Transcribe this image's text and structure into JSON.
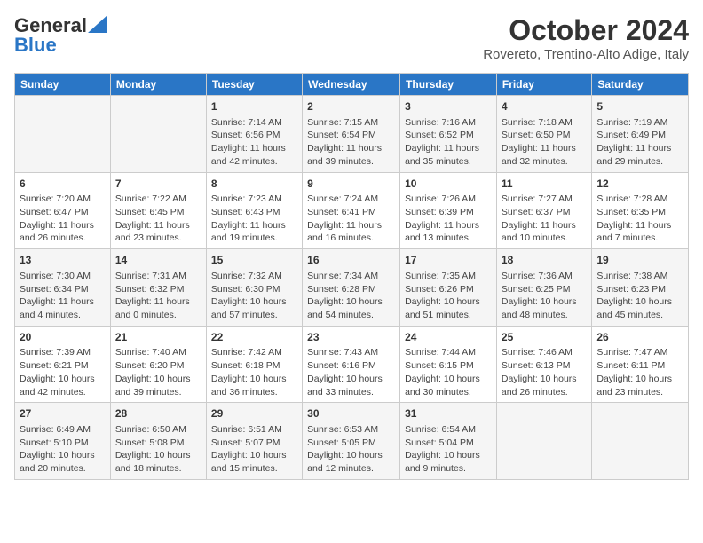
{
  "header": {
    "logo_general": "General",
    "logo_blue": "Blue",
    "month": "October 2024",
    "location": "Rovereto, Trentino-Alto Adige, Italy"
  },
  "days_of_week": [
    "Sunday",
    "Monday",
    "Tuesday",
    "Wednesday",
    "Thursday",
    "Friday",
    "Saturday"
  ],
  "weeks": [
    [
      {
        "day": "",
        "content": ""
      },
      {
        "day": "",
        "content": ""
      },
      {
        "day": "1",
        "content": "Sunrise: 7:14 AM\nSunset: 6:56 PM\nDaylight: 11 hours and 42 minutes."
      },
      {
        "day": "2",
        "content": "Sunrise: 7:15 AM\nSunset: 6:54 PM\nDaylight: 11 hours and 39 minutes."
      },
      {
        "day": "3",
        "content": "Sunrise: 7:16 AM\nSunset: 6:52 PM\nDaylight: 11 hours and 35 minutes."
      },
      {
        "day": "4",
        "content": "Sunrise: 7:18 AM\nSunset: 6:50 PM\nDaylight: 11 hours and 32 minutes."
      },
      {
        "day": "5",
        "content": "Sunrise: 7:19 AM\nSunset: 6:49 PM\nDaylight: 11 hours and 29 minutes."
      }
    ],
    [
      {
        "day": "6",
        "content": "Sunrise: 7:20 AM\nSunset: 6:47 PM\nDaylight: 11 hours and 26 minutes."
      },
      {
        "day": "7",
        "content": "Sunrise: 7:22 AM\nSunset: 6:45 PM\nDaylight: 11 hours and 23 minutes."
      },
      {
        "day": "8",
        "content": "Sunrise: 7:23 AM\nSunset: 6:43 PM\nDaylight: 11 hours and 19 minutes."
      },
      {
        "day": "9",
        "content": "Sunrise: 7:24 AM\nSunset: 6:41 PM\nDaylight: 11 hours and 16 minutes."
      },
      {
        "day": "10",
        "content": "Sunrise: 7:26 AM\nSunset: 6:39 PM\nDaylight: 11 hours and 13 minutes."
      },
      {
        "day": "11",
        "content": "Sunrise: 7:27 AM\nSunset: 6:37 PM\nDaylight: 11 hours and 10 minutes."
      },
      {
        "day": "12",
        "content": "Sunrise: 7:28 AM\nSunset: 6:35 PM\nDaylight: 11 hours and 7 minutes."
      }
    ],
    [
      {
        "day": "13",
        "content": "Sunrise: 7:30 AM\nSunset: 6:34 PM\nDaylight: 11 hours and 4 minutes."
      },
      {
        "day": "14",
        "content": "Sunrise: 7:31 AM\nSunset: 6:32 PM\nDaylight: 11 hours and 0 minutes."
      },
      {
        "day": "15",
        "content": "Sunrise: 7:32 AM\nSunset: 6:30 PM\nDaylight: 10 hours and 57 minutes."
      },
      {
        "day": "16",
        "content": "Sunrise: 7:34 AM\nSunset: 6:28 PM\nDaylight: 10 hours and 54 minutes."
      },
      {
        "day": "17",
        "content": "Sunrise: 7:35 AM\nSunset: 6:26 PM\nDaylight: 10 hours and 51 minutes."
      },
      {
        "day": "18",
        "content": "Sunrise: 7:36 AM\nSunset: 6:25 PM\nDaylight: 10 hours and 48 minutes."
      },
      {
        "day": "19",
        "content": "Sunrise: 7:38 AM\nSunset: 6:23 PM\nDaylight: 10 hours and 45 minutes."
      }
    ],
    [
      {
        "day": "20",
        "content": "Sunrise: 7:39 AM\nSunset: 6:21 PM\nDaylight: 10 hours and 42 minutes."
      },
      {
        "day": "21",
        "content": "Sunrise: 7:40 AM\nSunset: 6:20 PM\nDaylight: 10 hours and 39 minutes."
      },
      {
        "day": "22",
        "content": "Sunrise: 7:42 AM\nSunset: 6:18 PM\nDaylight: 10 hours and 36 minutes."
      },
      {
        "day": "23",
        "content": "Sunrise: 7:43 AM\nSunset: 6:16 PM\nDaylight: 10 hours and 33 minutes."
      },
      {
        "day": "24",
        "content": "Sunrise: 7:44 AM\nSunset: 6:15 PM\nDaylight: 10 hours and 30 minutes."
      },
      {
        "day": "25",
        "content": "Sunrise: 7:46 AM\nSunset: 6:13 PM\nDaylight: 10 hours and 26 minutes."
      },
      {
        "day": "26",
        "content": "Sunrise: 7:47 AM\nSunset: 6:11 PM\nDaylight: 10 hours and 23 minutes."
      }
    ],
    [
      {
        "day": "27",
        "content": "Sunrise: 6:49 AM\nSunset: 5:10 PM\nDaylight: 10 hours and 20 minutes."
      },
      {
        "day": "28",
        "content": "Sunrise: 6:50 AM\nSunset: 5:08 PM\nDaylight: 10 hours and 18 minutes."
      },
      {
        "day": "29",
        "content": "Sunrise: 6:51 AM\nSunset: 5:07 PM\nDaylight: 10 hours and 15 minutes."
      },
      {
        "day": "30",
        "content": "Sunrise: 6:53 AM\nSunset: 5:05 PM\nDaylight: 10 hours and 12 minutes."
      },
      {
        "day": "31",
        "content": "Sunrise: 6:54 AM\nSunset: 5:04 PM\nDaylight: 10 hours and 9 minutes."
      },
      {
        "day": "",
        "content": ""
      },
      {
        "day": "",
        "content": ""
      }
    ]
  ]
}
